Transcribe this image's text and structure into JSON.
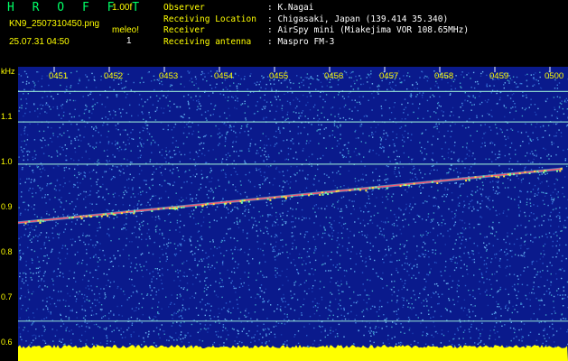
{
  "header": {
    "title": "H R O F F T",
    "version": "1.00f",
    "filename": "KN9_2507310450.png",
    "datetime": "25.07.31 04:50",
    "meleo_label": "meleo!",
    "meleo_value": "1",
    "info": [
      {
        "key": "Observer",
        "value": ": K.Nagai"
      },
      {
        "key": "Receiving Location",
        "value": ": Chigasaki, Japan (139.414 35.340)"
      },
      {
        "key": "Receiver",
        "value": ": AirSpy mini (Miakejima VOR 108.65MHz)"
      },
      {
        "key": "Receiving antenna",
        "value": ": Maspro FM-3"
      }
    ]
  },
  "chart_data": {
    "type": "heatmap",
    "ylabel": "kHz",
    "y_ticks": [
      "1.1",
      "1.0",
      "0.9",
      "0.8",
      "0.7",
      "0.6"
    ],
    "x_ticks": [
      "0451",
      "0452",
      "0453",
      "0454",
      "0455",
      "0456",
      "0457",
      "0458",
      "0459",
      "0500"
    ],
    "horizontal_lines_khz": [
      1.11,
      1.045,
      0.955,
      0.62
    ],
    "trace": {
      "start_khz": 0.83,
      "end_khz": 0.945
    },
    "colors": {
      "background": "#0a1a8c",
      "noise": "#3a7ad8",
      "line": "#9ef0d8",
      "trace": "#ff5070",
      "floor": "#ffff00"
    }
  }
}
